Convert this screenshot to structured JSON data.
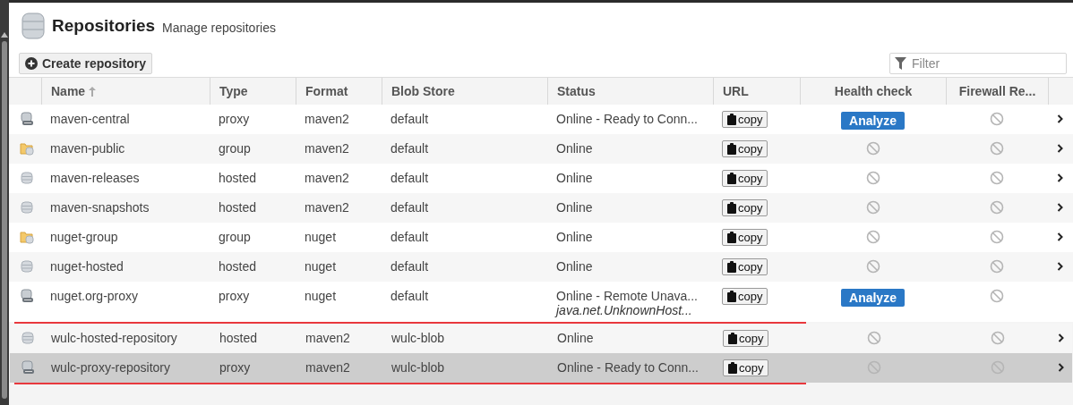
{
  "header": {
    "title": "Repositories",
    "subtitle": "Manage repositories"
  },
  "toolbar": {
    "create_button": "Create repository",
    "filter": {
      "placeholder": "Filter"
    }
  },
  "table": {
    "columns": [
      {
        "label": "Name",
        "sorted": true
      },
      {
        "label": "Type",
        "sorted": false
      },
      {
        "label": "Format",
        "sorted": false
      },
      {
        "label": "Blob Store",
        "sorted": false
      },
      {
        "label": "Status",
        "sorted": false
      },
      {
        "label": "URL",
        "sorted": false
      },
      {
        "label": "Health check",
        "sorted": false
      },
      {
        "label": "Firewall Re...",
        "sorted": false
      }
    ],
    "rows": [
      {
        "name": "maven-central",
        "type": "proxy",
        "format": "maven2",
        "blob_store": "default",
        "status": "Online - Ready to Conn...",
        "url_button": "copy",
        "health": {
          "kind": "analyze",
          "label": "Analyze"
        },
        "chevron": true,
        "selected": false,
        "marked": false
      },
      {
        "name": "maven-public",
        "type": "group",
        "format": "maven2",
        "blob_store": "default",
        "status": "Online",
        "url_button": "copy",
        "health": {
          "kind": "none"
        },
        "chevron": true,
        "selected": false,
        "marked": false
      },
      {
        "name": "maven-releases",
        "type": "hosted",
        "format": "maven2",
        "blob_store": "default",
        "status": "Online",
        "url_button": "copy",
        "health": {
          "kind": "none"
        },
        "chevron": true,
        "selected": false,
        "marked": false
      },
      {
        "name": "maven-snapshots",
        "type": "hosted",
        "format": "maven2",
        "blob_store": "default",
        "status": "Online",
        "url_button": "copy",
        "health": {
          "kind": "none"
        },
        "chevron": true,
        "selected": false,
        "marked": false
      },
      {
        "name": "nuget-group",
        "type": "group",
        "format": "nuget",
        "blob_store": "default",
        "status": "Online",
        "url_button": "copy",
        "health": {
          "kind": "none"
        },
        "chevron": true,
        "selected": false,
        "marked": false
      },
      {
        "name": "nuget-hosted",
        "type": "hosted",
        "format": "nuget",
        "blob_store": "default",
        "status": "Online",
        "url_button": "copy",
        "health": {
          "kind": "none"
        },
        "chevron": true,
        "selected": false,
        "marked": false
      },
      {
        "name": "nuget.org-proxy",
        "type": "proxy",
        "format": "nuget",
        "blob_store": "default",
        "status": "Online - Remote Unava...",
        "status_detail": "java.net.UnknownHost...",
        "url_button": "copy",
        "health": {
          "kind": "analyze",
          "label": "Analyze"
        },
        "chevron": false,
        "selected": false,
        "marked": false
      },
      {
        "name": "wulc-hosted-repository",
        "type": "hosted",
        "format": "maven2",
        "blob_store": "wulc-blob",
        "status": "Online",
        "url_button": "copy",
        "health": {
          "kind": "none"
        },
        "chevron": true,
        "selected": false,
        "marked": true
      },
      {
        "name": "wulc-proxy-repository",
        "type": "proxy",
        "format": "maven2",
        "blob_store": "wulc-blob",
        "status": "Online - Ready to Conn...",
        "url_button": "copy",
        "health": {
          "kind": "none"
        },
        "chevron": true,
        "selected": true,
        "marked": true
      }
    ]
  }
}
